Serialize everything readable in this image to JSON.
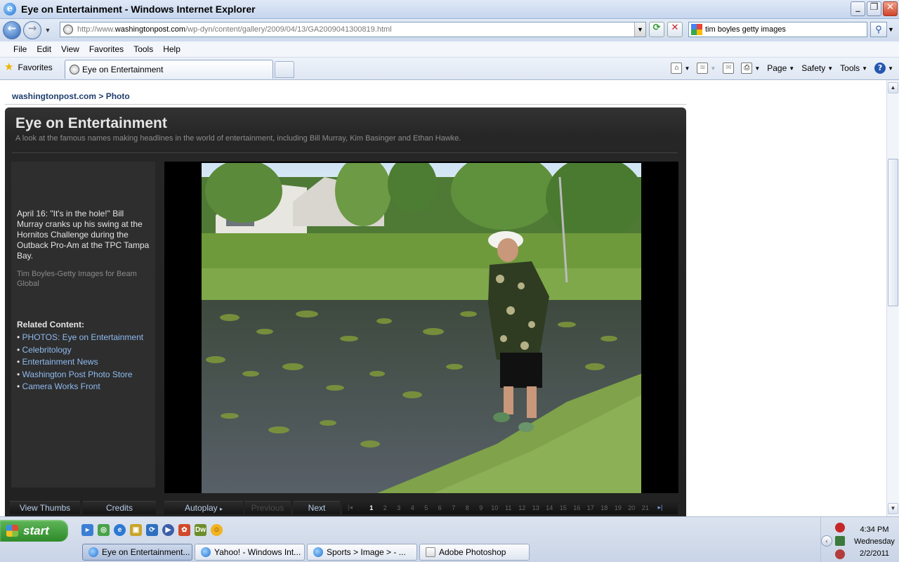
{
  "window": {
    "title": "Eye on Entertainment - Windows Internet Explorer"
  },
  "address_bar": {
    "url_prefix": "http://www.",
    "url_host": "washingtonpost.com",
    "url_path": "/wp-dyn/content/gallery/2009/04/13/GA2009041300819.html",
    "search_value": "tim boyles getty images"
  },
  "menu": [
    "File",
    "Edit",
    "View",
    "Favorites",
    "Tools",
    "Help"
  ],
  "tabs": {
    "favorites_label": "Favorites",
    "active_tab": "Eye on Entertainment"
  },
  "command_bar": {
    "page": "Page",
    "safety": "Safety",
    "tools": "Tools"
  },
  "page": {
    "breadcrumb_site": "washingtonpost.com",
    "breadcrumb_sep": " > ",
    "breadcrumb_section": "Photo",
    "gallery_title": "Eye on Entertainment",
    "gallery_subtitle": "A look at the famous names making headlines in the world of entertainment, including Bill Murray, Kim Basinger and Ethan Hawke.",
    "caption": "April 16: \"It's in the hole!\" Bill Murray cranks up his swing at the Hornitos Challenge during the Outback Pro-Am at the TPC Tampa Bay.",
    "credit": "Tim Boyles-Getty Images for Beam Global",
    "related_title": "Related Content:",
    "related_links": [
      "PHOTOS: Eye on Entertainment",
      "Celebritology",
      "Entertainment News",
      "Washington Post Photo Store",
      "Camera Works Front"
    ],
    "view_thumbs": "View Thumbs",
    "credits": "Credits",
    "autoplay": "Autoplay",
    "previous": "Previous",
    "next": "Next",
    "pages": [
      "1",
      "2",
      "3",
      "4",
      "5",
      "6",
      "7",
      "8",
      "9",
      "10",
      "11",
      "12",
      "13",
      "14",
      "15",
      "16",
      "17",
      "18",
      "19",
      "20",
      "21"
    ],
    "current_page": "1"
  },
  "taskbar": {
    "start": "start",
    "tasks": [
      "Eye on Entertainment...",
      "Yahoo! - Windows Int...",
      "Sports > Image > - ...",
      "Adobe Photoshop"
    ],
    "time": "4:34 PM",
    "day": "Wednesday",
    "date": "2/2/2011"
  }
}
